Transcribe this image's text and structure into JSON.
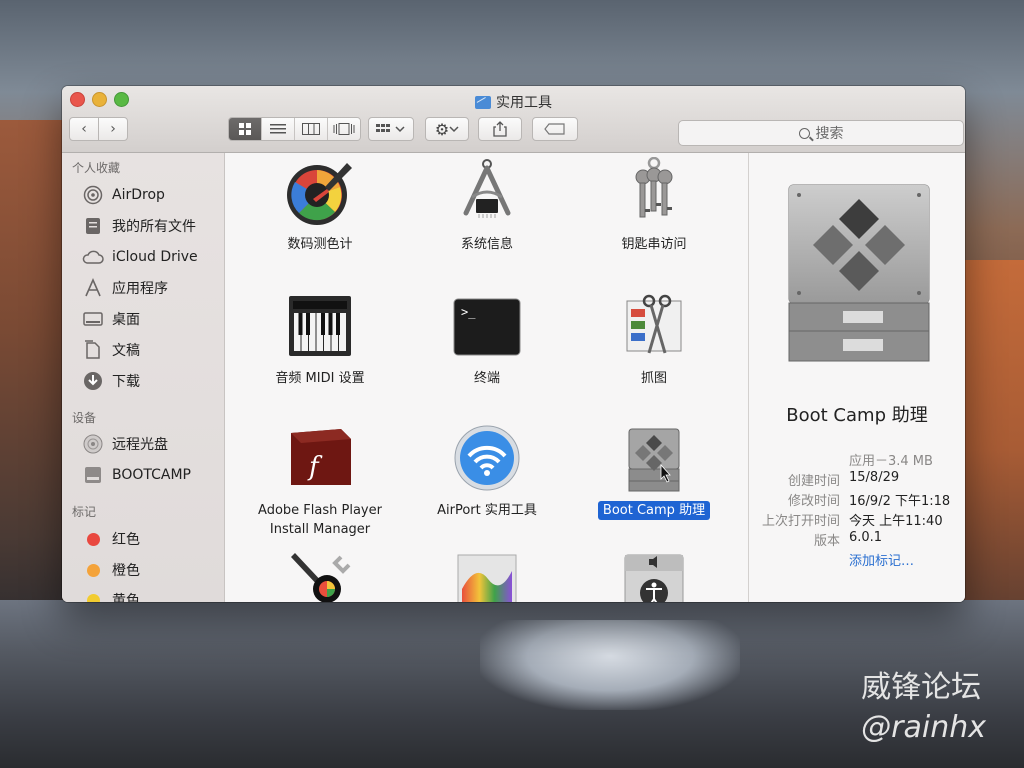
{
  "window": {
    "title": "实用工具",
    "search_placeholder": "搜索"
  },
  "toolbar": {
    "back_glyph": "‹",
    "forward_glyph": "›",
    "view_modes": [
      "icon-view",
      "list-view",
      "column-view",
      "cover-flow-view"
    ],
    "arrange_icon": "arrange-icon",
    "action_icon": "gear-icon",
    "share_icon": "share-icon",
    "tag_icon": "tag-icon"
  },
  "sidebar": {
    "favorites_header": "个人收藏",
    "favorites": [
      {
        "label": "AirDrop",
        "icon": "airdrop-icon"
      },
      {
        "label": "我的所有文件",
        "icon": "all-files-icon"
      },
      {
        "label": "iCloud Drive",
        "icon": "cloud-icon"
      },
      {
        "label": "应用程序",
        "icon": "applications-icon"
      },
      {
        "label": "桌面",
        "icon": "desktop-icon"
      },
      {
        "label": "文稿",
        "icon": "documents-icon"
      },
      {
        "label": "下载",
        "icon": "downloads-icon"
      }
    ],
    "devices_header": "设备",
    "devices": [
      {
        "label": "远程光盘",
        "icon": "remote-disc-icon"
      },
      {
        "label": "BOOTCAMP",
        "icon": "disk-icon"
      }
    ],
    "tags_header": "标记",
    "tags": [
      {
        "label": "红色",
        "color": "#e9483f"
      },
      {
        "label": "橙色",
        "color": "#f4a33a"
      },
      {
        "label": "黄色",
        "color": "#f2cc30"
      }
    ]
  },
  "apps": [
    {
      "label": "数码测色计",
      "icon": "digital-color-meter-icon"
    },
    {
      "label": "系统信息",
      "icon": "system-information-icon"
    },
    {
      "label": "钥匙串访问",
      "icon": "keychain-access-icon"
    },
    {
      "label": "音频 MIDI 设置",
      "icon": "audio-midi-setup-icon"
    },
    {
      "label": "终端",
      "icon": "terminal-icon"
    },
    {
      "label": "抓图",
      "icon": "grab-icon"
    },
    {
      "label": "Adobe Flash Player\nInstall Manager",
      "label_line1": "Adobe Flash Player",
      "label_line2": "Install Manager",
      "icon": "flash-player-icon"
    },
    {
      "label": "AirPort 实用工具",
      "icon": "airport-utility-icon"
    },
    {
      "label": "Boot Camp 助理",
      "icon": "boot-camp-icon",
      "selected": true
    },
    {
      "label": "",
      "icon": "colorsync-utility-icon"
    },
    {
      "label": "",
      "icon": "grapher-icon"
    },
    {
      "label": "",
      "icon": "voiceover-utility-icon"
    }
  ],
  "preview": {
    "name": "Boot Camp 助理",
    "kind_size": "应用－3.4 MB",
    "created_key": "创建时间",
    "created_val": "15/8/29",
    "modified_key": "修改时间",
    "modified_val": "16/9/2 下午1:18",
    "opened_key": "上次打开时间",
    "opened_val": "今天 上午11:40",
    "version_key": "版本",
    "version_val": "6.0.1",
    "add_tags": "添加标记…"
  },
  "watermark": {
    "site": "威锋论坛",
    "handle": "@rainhx"
  }
}
